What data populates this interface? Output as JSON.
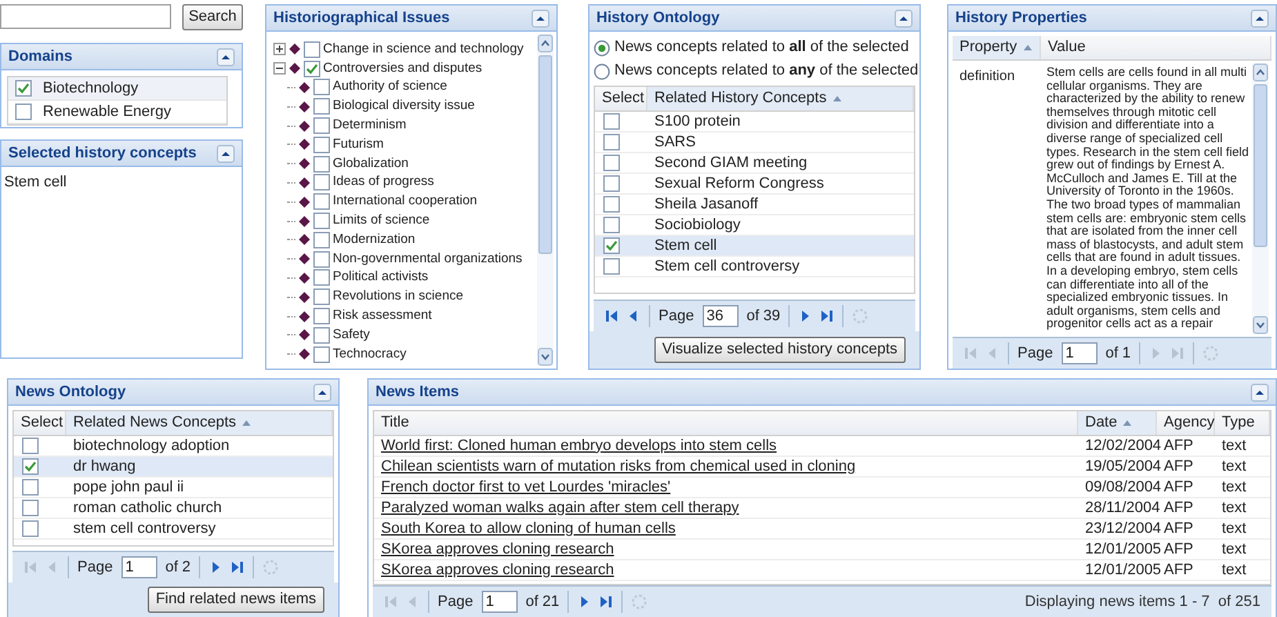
{
  "search": {
    "button": "Search"
  },
  "domains": {
    "title": "Domains",
    "items": [
      {
        "label": "Biotechnology",
        "checked": true
      },
      {
        "label": "Renewable Energy",
        "checked": false
      }
    ]
  },
  "selected_concepts": {
    "title": "Selected history concepts",
    "items": [
      "Stem cell"
    ]
  },
  "issues": {
    "title": "Historiographical Issues",
    "tree": [
      {
        "label": "Change in science and technology",
        "checked": false,
        "expanded": false
      },
      {
        "label": "Controversies and disputes",
        "checked": true,
        "expanded": true,
        "children": [
          {
            "label": "Authority of science",
            "checked": false
          },
          {
            "label": "Biological diversity issue",
            "checked": false
          },
          {
            "label": "Determinism",
            "checked": false
          },
          {
            "label": "Futurism",
            "checked": false
          },
          {
            "label": "Globalization",
            "checked": false
          },
          {
            "label": "Ideas of progress",
            "checked": false
          },
          {
            "label": "International cooperation",
            "checked": false
          },
          {
            "label": "Limits of science",
            "checked": false
          },
          {
            "label": "Modernization",
            "checked": false
          },
          {
            "label": "Non-governmental organizations",
            "checked": false
          },
          {
            "label": "Political activists",
            "checked": false
          },
          {
            "label": "Revolutions in science",
            "checked": false
          },
          {
            "label": "Risk assessment",
            "checked": false
          },
          {
            "label": "Safety",
            "checked": false
          },
          {
            "label": "Technocracy",
            "checked": false
          }
        ]
      }
    ]
  },
  "history_ontology": {
    "title": "History Ontology",
    "options": [
      {
        "label": "News concepts related to **all** of the selected",
        "selected": true
      },
      {
        "label": "News concepts related to **any** of the selected",
        "selected": false
      }
    ],
    "columns": [
      {
        "label": "Select",
        "sorted": false
      },
      {
        "label": "Related History Concepts",
        "sorted": true
      }
    ],
    "rows": [
      {
        "concept": "S100 protein",
        "checked": false
      },
      {
        "concept": "SARS",
        "checked": false
      },
      {
        "concept": "Second GIAM meeting",
        "checked": false
      },
      {
        "concept": "Sexual Reform Congress",
        "checked": false
      },
      {
        "concept": "Sheila Jasanoff",
        "checked": false
      },
      {
        "concept": "Sociobiology",
        "checked": false
      },
      {
        "concept": "Stem cell",
        "checked": true
      },
      {
        "concept": "Stem cell controversy",
        "checked": false
      }
    ],
    "pager": {
      "label": "Page",
      "page": "36",
      "of": "of 39",
      "prev_enabled": true,
      "next_enabled": true
    },
    "button": "Visualize selected history concepts"
  },
  "history_properties": {
    "title": "History Properties",
    "columns": [
      {
        "label": "Property",
        "sorted": true
      },
      {
        "label": "Value",
        "sorted": false
      }
    ],
    "rows": [
      {
        "property": "definition",
        "value": "Stem cells are cells found in all multi cellular organisms. They are characterized by the ability to renew themselves through mitotic cell division and differentiate into a diverse range of specialized cell types. Research in the stem cell field grew out of findings by Ernest A. McCulloch and James E. Till at the University of Toronto in the 1960s. The two broad types of mammalian stem cells are: embryonic stem cells that are isolated from the inner cell mass of blastocysts, and adult stem cells that are found in adult tissues. In a developing embryo, stem cells can differentiate into all of the specialized embryonic tissues. In adult organisms, stem cells and progenitor cells act as a repair"
      }
    ],
    "pager": {
      "label": "Page",
      "page": "1",
      "of": "of 1",
      "prev_enabled": false,
      "next_enabled": false
    }
  },
  "news_ontology": {
    "title": "News Ontology",
    "columns": [
      {
        "label": "Select",
        "sorted": false
      },
      {
        "label": "Related News Concepts",
        "sorted": true
      }
    ],
    "rows": [
      {
        "concept": "biotechnology adoption",
        "checked": false
      },
      {
        "concept": "dr hwang",
        "checked": true
      },
      {
        "concept": "pope john paul ii",
        "checked": false
      },
      {
        "concept": "roman catholic church",
        "checked": false
      },
      {
        "concept": "stem cell controversy",
        "checked": false
      }
    ],
    "pager": {
      "label": "Page",
      "page": "1",
      "of": "of 2",
      "prev_enabled": false,
      "next_enabled": true
    },
    "button": "Find related news items"
  },
  "news_items": {
    "title": "News Items",
    "columns": [
      {
        "label": "Title",
        "sorted": false
      },
      {
        "label": "Date",
        "sorted": true
      },
      {
        "label": "Agency",
        "sorted": false
      },
      {
        "label": "Type",
        "sorted": false
      }
    ],
    "rows": [
      {
        "title": "World first: Cloned human embryo develops into stem cells",
        "date": "12/02/2004",
        "agency": "AFP",
        "type": "text"
      },
      {
        "title": "Chilean scientists warn of mutation risks from chemical used in cloning",
        "date": "19/05/2004",
        "agency": "AFP",
        "type": "text"
      },
      {
        "title": "French doctor first to vet Lourdes 'miracles'",
        "date": "09/08/2004",
        "agency": "AFP",
        "type": "text"
      },
      {
        "title": "Paralyzed woman walks again after stem cell therapy",
        "date": "28/11/2004",
        "agency": "AFP",
        "type": "text"
      },
      {
        "title": "South Korea to allow cloning of human cells",
        "date": "23/12/2004",
        "agency": "AFP",
        "type": "text"
      },
      {
        "title": "SKorea approves cloning research",
        "date": "12/01/2005",
        "agency": "AFP",
        "type": "text"
      },
      {
        "title": "SKorea approves cloning research",
        "date": "12/01/2005",
        "agency": "AFP",
        "type": "text"
      }
    ],
    "pager": {
      "label": "Page",
      "page": "1",
      "of": "of 21",
      "prev_enabled": false,
      "next_enabled": true
    },
    "status": "Displaying news items 1 - 7  of 251"
  }
}
